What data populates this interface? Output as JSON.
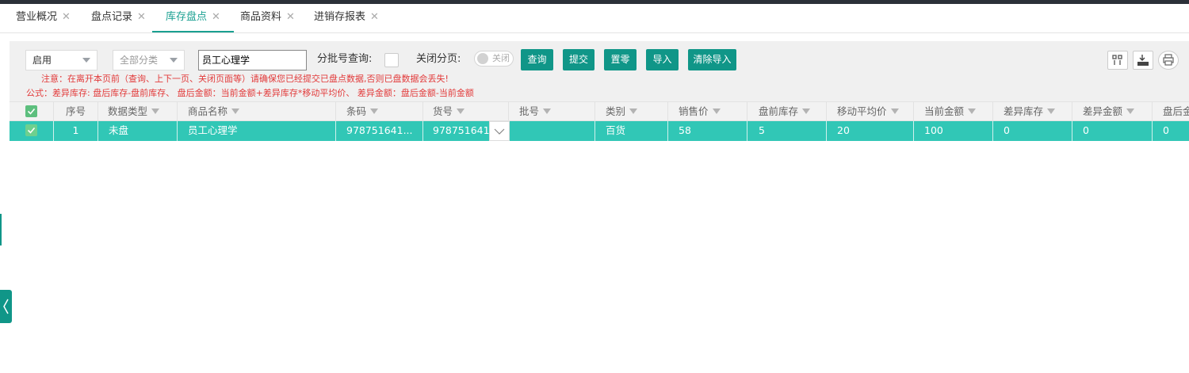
{
  "tabs": [
    {
      "label": "营业概况",
      "active": false
    },
    {
      "label": "盘点记录",
      "active": false
    },
    {
      "label": "库存盘点",
      "active": true
    },
    {
      "label": "商品资料",
      "active": false
    },
    {
      "label": "进销存报表",
      "active": false
    }
  ],
  "tab_close": "✕",
  "filters": {
    "status_select": "启用",
    "category_select": "全部分类",
    "search_value": "员工心理学",
    "batch_query_label": "分批号查询:",
    "close_paging_label": "关闭分页:",
    "toggle_text": "关闭"
  },
  "buttons": {
    "query": "查询",
    "submit": "提交",
    "reset_zero": "置零",
    "import": "导入",
    "clear_import": "清除导入"
  },
  "notes": {
    "warning": "注意：在离开本页前（查询、上下一页、关闭页面等）请确保您已经提交已盘点数据,否则已盘数据会丢失!",
    "formula": "公式：差异库存: 盘后库存-盘前库存、 盘后金额：当前金额+差异库存*移动平均价、 差异金额：盘后金额-当前金额"
  },
  "toolbar_icons": [
    "columns-icon",
    "export-icon",
    "print-icon"
  ],
  "table": {
    "columns": [
      "序号",
      "数据类型",
      "商品名称",
      "条码",
      "货号",
      "批号",
      "类别",
      "销售价",
      "盘前库存",
      "移动平均价",
      "当前金额",
      "差异库存",
      "差异金额",
      "盘后金"
    ],
    "rows": [
      {
        "cells": [
          "1",
          "未盘",
          "员工心理学",
          "978751641...",
          "978751641...",
          "",
          "百货",
          "58",
          "5",
          "20",
          "100",
          "0",
          "0",
          "0"
        ]
      }
    ]
  },
  "colors": {
    "accent": "#109688",
    "selected_row": "#31c7b6",
    "warning_text": "#e23a3a"
  }
}
